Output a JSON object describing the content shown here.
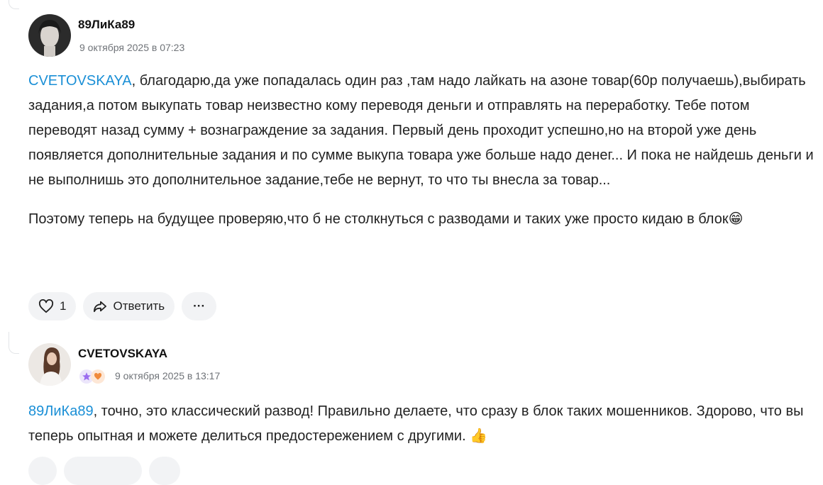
{
  "comments": [
    {
      "author": "89ЛиКа89",
      "date": "9 октября 2025 в 07:23",
      "mention": "CVETOVSKAYA",
      "paragraph1": ", благодарю,да уже попадалась один раз ,там надо лайкать на азоне товар(60р получаешь),выбирать задания,а потом выкупать товар неизвестно кому переводя деньги и отправлять на переработку. Тебе потом переводят назад сумму + вознаграждение за задания. Первый день проходит успешно,но на второй уже день появляется дополнительные задания и по сумме выкупа товара уже больше надо денег... И пока не найдешь деньги и не выполнишь это дополнительное задание,тебе не вернут, то что ты внесла за товар...",
      "paragraph2": "Поэтому теперь на будущее проверяю,что б не столкнуться с разводами и таких уже просто кидаю в блок😁",
      "likes": "1",
      "reply_label": "Ответить",
      "more_label": "···"
    },
    {
      "author": "CVETOVSKAYA",
      "date": "9 октября 2025 в 13:17",
      "mention": "89ЛиКа89",
      "paragraph1": ", точно, это классический развод! Правильно делаете, что сразу в блок таких мошенников. Здорово, что вы теперь опытная и можете делиться предостережением с другими. 👍"
    }
  ],
  "colors": {
    "mention": "#1a8fd6",
    "pill_bg": "#f2f3f5",
    "badge_purple": "#9b6cf0",
    "badge_orange": "#f08a3c"
  }
}
